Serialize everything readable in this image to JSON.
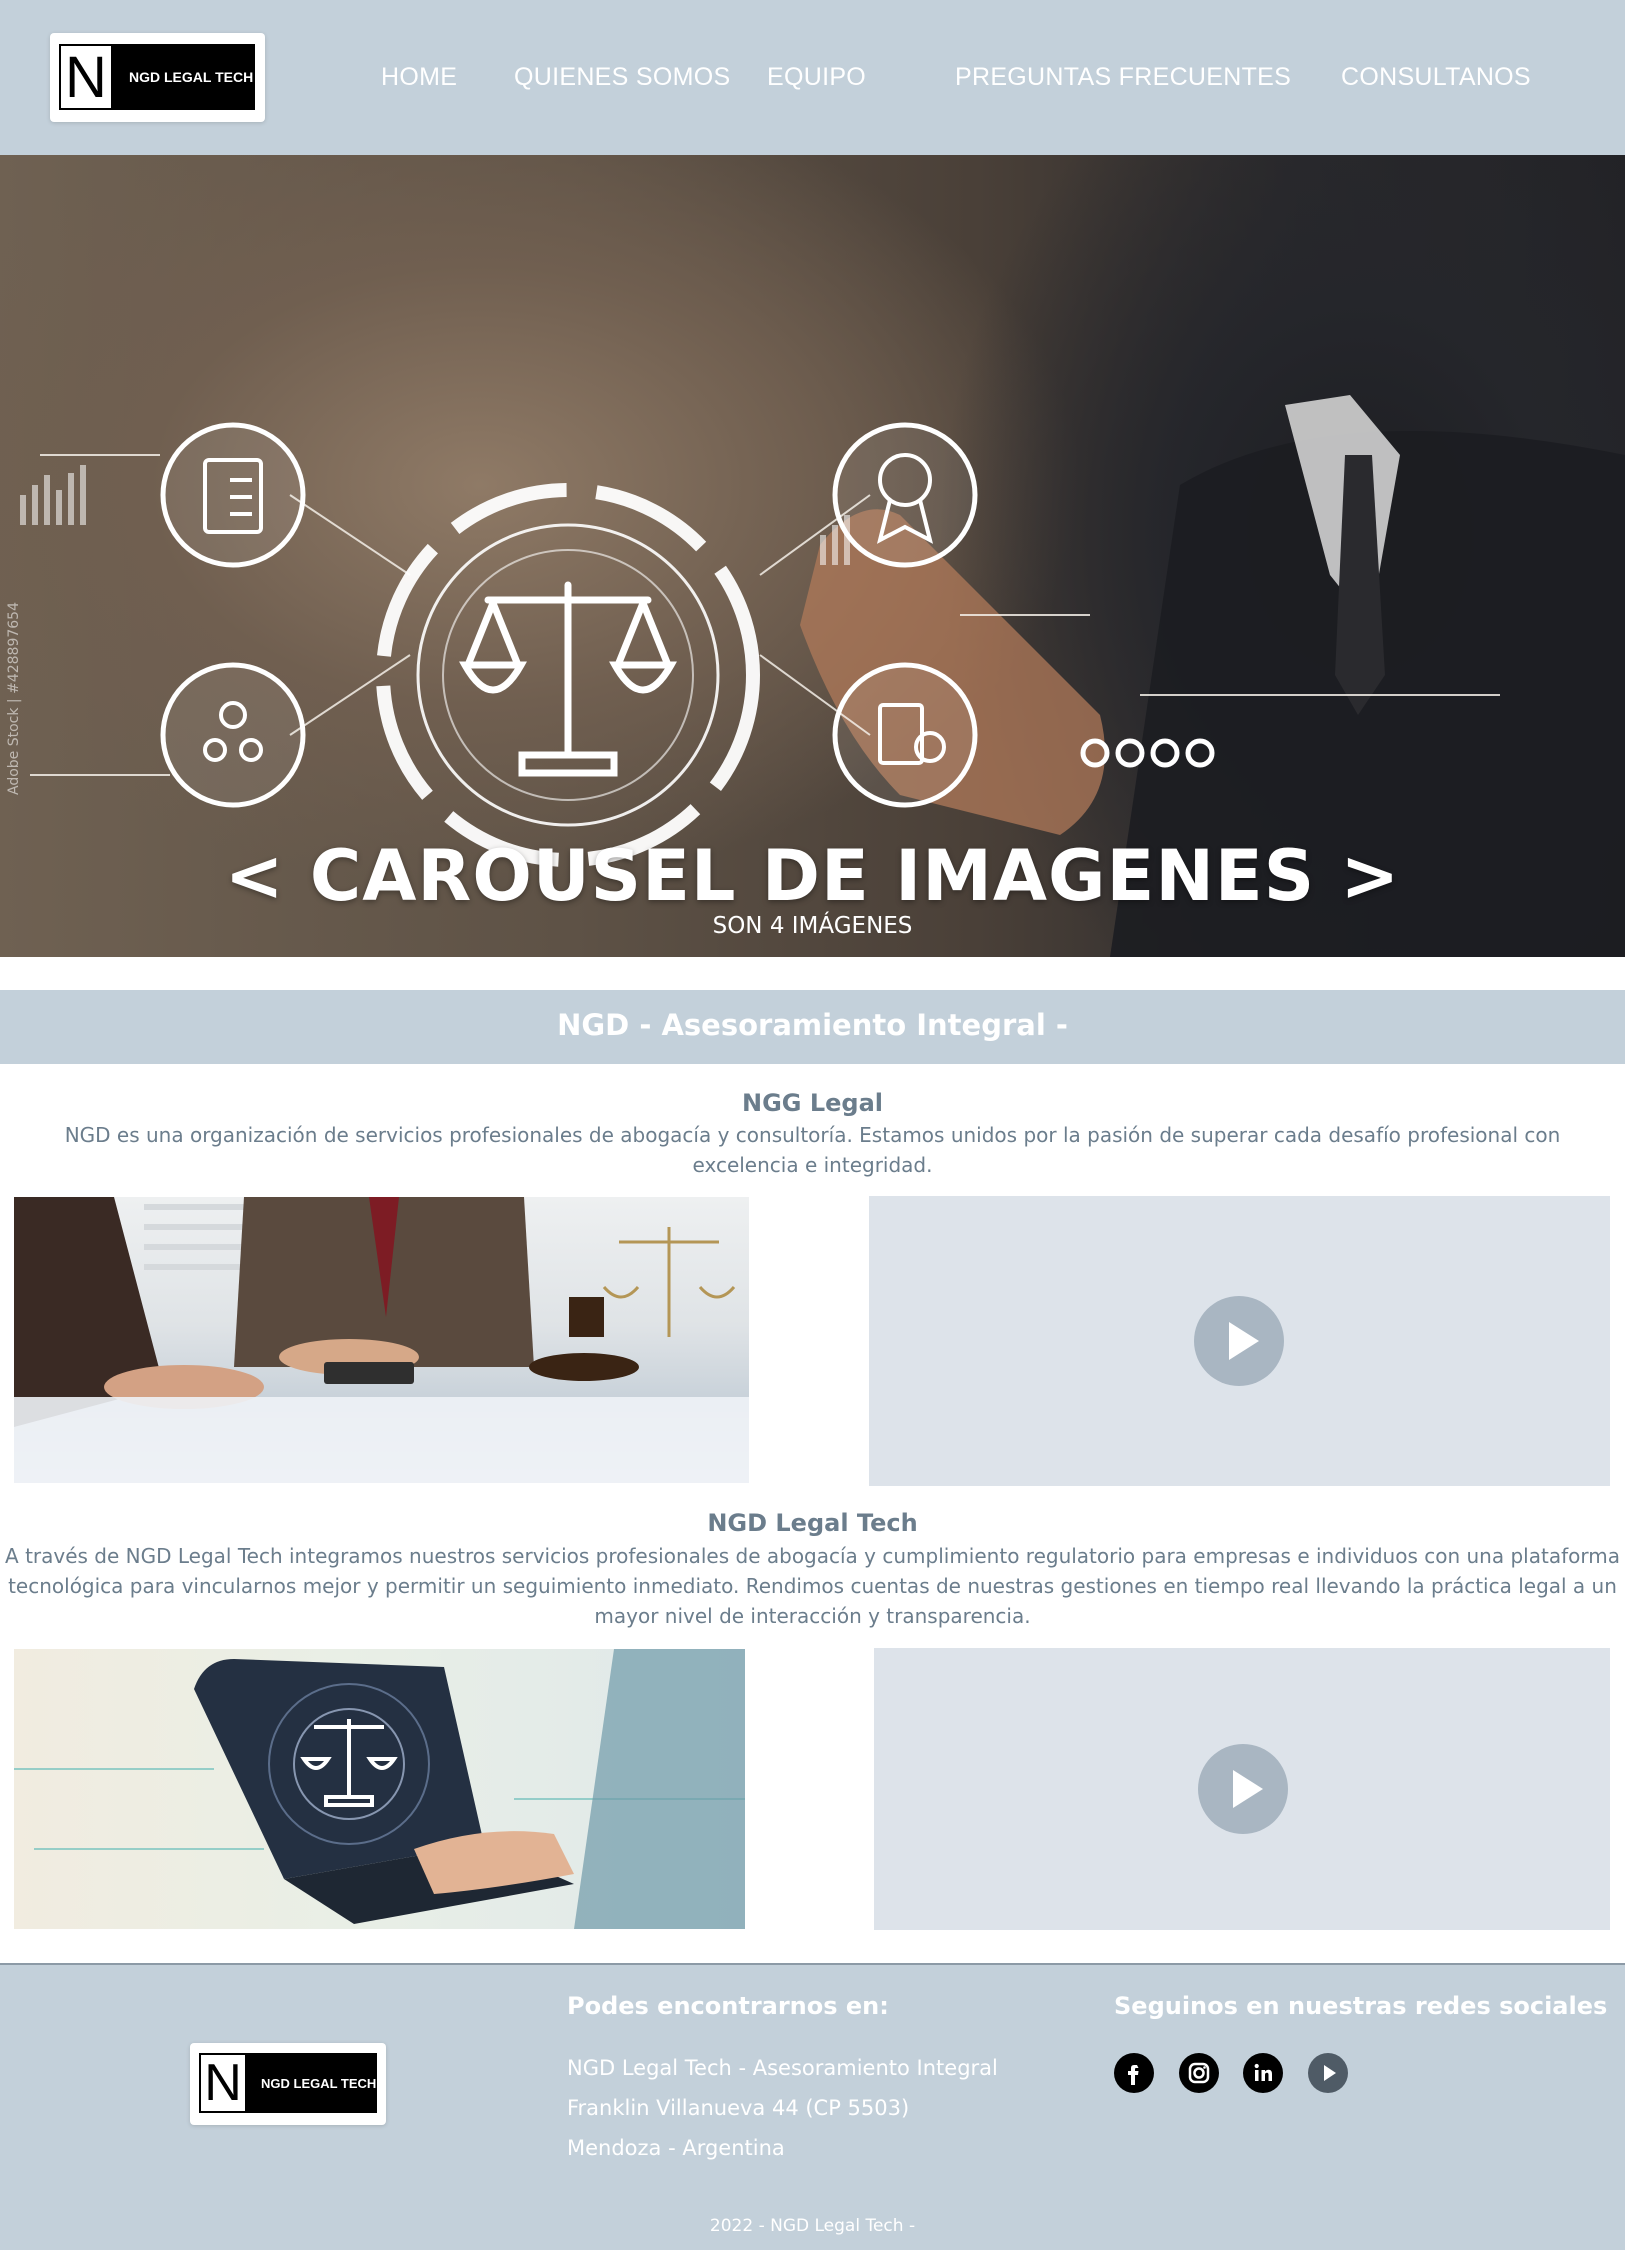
{
  "header": {
    "logo_letter": "N",
    "logo_text": "NGD LEGAL TECH",
    "nav": [
      "HOME",
      "QUIENES SOMOS",
      "EQUIPO",
      "PREGUNTAS FRECUENTES",
      "CONSULTANOS"
    ]
  },
  "hero": {
    "title": "< CAROUSEL DE IMAGENES >",
    "subtitle": "SON 4 IMÁGENES",
    "watermark": "Adobe Stock | #428897654"
  },
  "section": {
    "title": "NGD - Asesoramiento Integral -"
  },
  "block1": {
    "title": "NGG Legal",
    "text": "NGD es una organización de servicios profesionales de abogacía y consultoría. Estamos unidos por la pasión de superar cada desafío profesional con excelencia e integridad."
  },
  "block2": {
    "title": "NGD Legal Tech",
    "text": "A través de NGD Legal Tech integramos nuestros servicios profesionales de abogacía y cumplimiento regulatorio para empresas e individuos con una plataforma tecnológica para vincularnos mejor y permitir un seguimiento inmediato. Rendimos cuentas de nuestras gestiones en tiempo real llevando la práctica legal a un mayor nivel de interacción y transparencia."
  },
  "footer": {
    "logo_letter": "N",
    "logo_text": "NGD LEGAL TECH",
    "find_title": "Podes encontrarnos en:",
    "find_lines": [
      "NGD Legal Tech - Asesoramiento Integral",
      "Franklin Villanueva 44 (CP 5503)",
      "Mendoza - Argentina"
    ],
    "social_title": "Seguinos en nuestras redes sociales",
    "social_icons": [
      "facebook-icon",
      "instagram-icon",
      "linkedin-icon",
      "youtube-icon"
    ],
    "copyright": "2022 - NGD Legal Tech -"
  },
  "colors": {
    "header_bg": "#c3d0da",
    "text_gray": "#6b7d8c",
    "video_bg": "#dde3ea",
    "play_btn": "#a9b6c2"
  }
}
